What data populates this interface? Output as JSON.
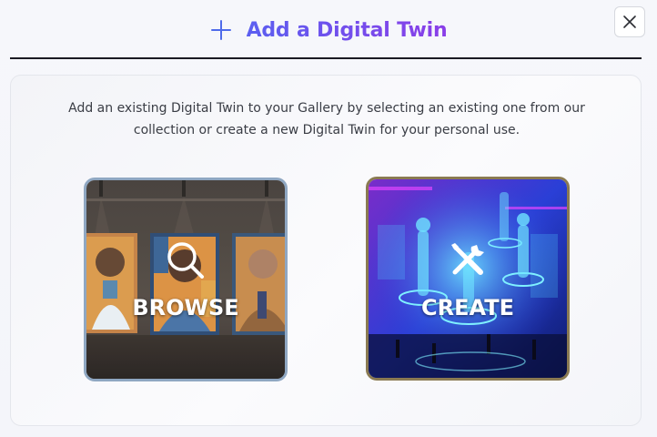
{
  "header": {
    "title": "Add a Digital Twin",
    "icon": "plus-icon",
    "accent_gradient": [
      "#5b5ff0",
      "#8a3ee8"
    ]
  },
  "close_button": {
    "icon": "close-icon"
  },
  "panel": {
    "description": "Add an existing Digital Twin to your Gallery by selecting an existing one from our collection or create a new Digital Twin for your personal use."
  },
  "options": [
    {
      "label": "BROWSE",
      "icon": "magnifier-icon",
      "border_color": "#8fa7c2"
    },
    {
      "label": "CREATE",
      "icon": "tools-icon",
      "border_color": "#8a7a52"
    }
  ]
}
